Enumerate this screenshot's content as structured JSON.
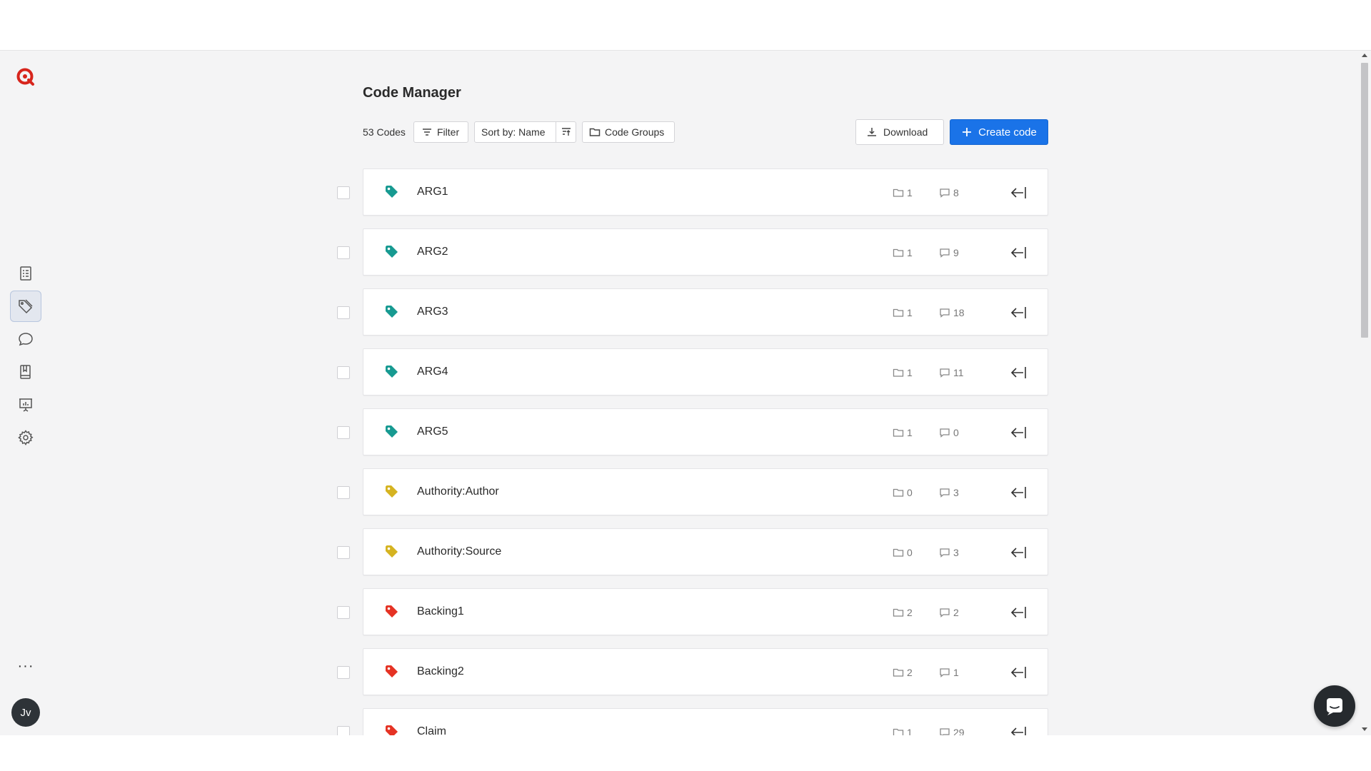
{
  "header": {
    "title": "Code Manager",
    "count_label": "53 Codes",
    "filter_label": "Filter",
    "sort_label": "Sort by: Name",
    "groups_label": "Code Groups",
    "download_label": "Download",
    "create_label": "Create code"
  },
  "sidebar": {
    "avatar_initials": "Jv",
    "more_label": "···",
    "items": [
      {
        "icon": "documents-icon"
      },
      {
        "icon": "codes-tag-icon",
        "active": true
      },
      {
        "icon": "quotations-icon"
      },
      {
        "icon": "memos-book-icon"
      },
      {
        "icon": "presentation-icon"
      },
      {
        "icon": "settings-gear-icon"
      }
    ]
  },
  "colors": {
    "accent": "#1a73e8",
    "tag_teal": "#179a91",
    "tag_yellow": "#d5b321",
    "tag_red": "#e53324",
    "logo_red": "#d7251c"
  },
  "codes": [
    {
      "name": "ARG1",
      "color": "#179a91",
      "groups": "1",
      "quotes": "8"
    },
    {
      "name": "ARG2",
      "color": "#179a91",
      "groups": "1",
      "quotes": "9"
    },
    {
      "name": "ARG3",
      "color": "#179a91",
      "groups": "1",
      "quotes": "18"
    },
    {
      "name": "ARG4",
      "color": "#179a91",
      "groups": "1",
      "quotes": "11"
    },
    {
      "name": "ARG5",
      "color": "#179a91",
      "groups": "1",
      "quotes": "0"
    },
    {
      "name": "Authority:Author",
      "color": "#d5b321",
      "groups": "0",
      "quotes": "3"
    },
    {
      "name": "Authority:Source",
      "color": "#d5b321",
      "groups": "0",
      "quotes": "3"
    },
    {
      "name": "Backing1",
      "color": "#e53324",
      "groups": "2",
      "quotes": "2"
    },
    {
      "name": "Backing2",
      "color": "#e53324",
      "groups": "2",
      "quotes": "1"
    },
    {
      "name": "Claim",
      "color": "#e53324",
      "groups": "1",
      "quotes": "29"
    }
  ]
}
